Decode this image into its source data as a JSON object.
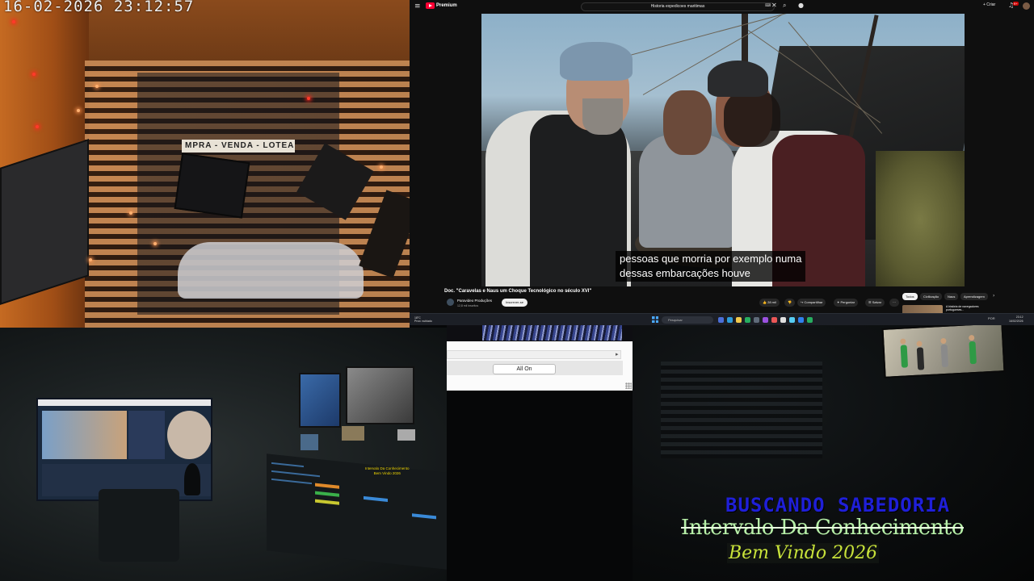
{
  "camera_top_left": {
    "timestamp": "16-02-2026  23:12:57",
    "sign_text": "MPRA - VENDA - LOTEAM"
  },
  "youtube": {
    "logo": "Premium",
    "search_query": "Historia expedicoes maritimas",
    "create_label": "+ Criar",
    "notification_count": "9+",
    "subtitle_line1": "pessoas que morria por exemplo numa",
    "subtitle_line2": "dessas embarcações houve",
    "video_title": "Doc. \"Caravelas e Naus um Choque Tecnológico no século XVI\"",
    "channel_name": "Paravideo Produções",
    "channel_subs": "12,8 mil inscritos",
    "subscribe_label": "Inscrever-se",
    "actions": {
      "like": "28 mil",
      "share": "Compartilhar",
      "ask": "Perguntar",
      "save": "Salvar",
      "more": "···"
    },
    "chips": [
      "Todos",
      "Civilização",
      "Naus",
      "Aprendizagem"
    ],
    "rec_text": "A história de navegadores portugueses..."
  },
  "taskbar": {
    "weather_temp": "18°C",
    "weather_desc": "Prod. nublado",
    "search_placeholder": "Pesquisar",
    "time": "23:12",
    "date": "16/02/2026",
    "lang": "POR"
  },
  "control_window": {
    "all_on_label": "All On"
  },
  "studio_overlay": {
    "line1": "Intervalo Da Conhecimento",
    "line2": "Bem Vindo 2026"
  },
  "logo_overlay": {
    "line1": "BUSCANDO SABEDORIA",
    "line2": "Intervalo Da Conhecimento",
    "line3": "Bem Vindo 2026"
  },
  "colors": {
    "youtube_red": "#ff0033",
    "logo_blue": "#1f1fd8",
    "logo_green": "#b7f0a8",
    "logo_yellow": "#c8e23a"
  }
}
